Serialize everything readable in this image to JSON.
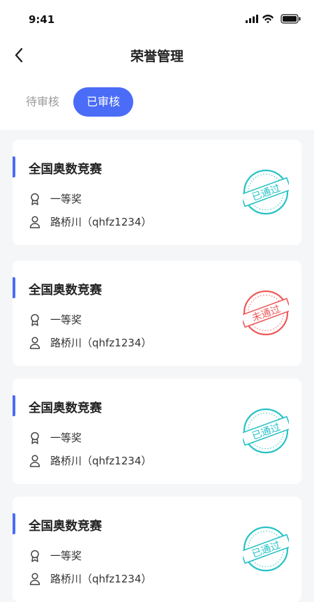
{
  "status_bar": {
    "time": "9:41"
  },
  "header": {
    "title": "荣誉管理"
  },
  "tabs": [
    {
      "label": "待审核",
      "active": false
    },
    {
      "label": "已审核",
      "active": true
    }
  ],
  "cards": [
    {
      "title": "全国奥数竞赛",
      "award": "一等奖",
      "person": "路桥川（qhfz1234）",
      "status": "已通过",
      "status_color": "#27c2c6"
    },
    {
      "title": "全国奥数竞赛",
      "award": "一等奖",
      "person": "路桥川（qhfz1234）",
      "status": "未通过",
      "status_color": "#ee5a5a"
    },
    {
      "title": "全国奥数竞赛",
      "award": "一等奖",
      "person": "路桥川（qhfz1234）",
      "status": "已通过",
      "status_color": "#27c2c6"
    },
    {
      "title": "全国奥数竞赛",
      "award": "一等奖",
      "person": "路桥川（qhfz1234）",
      "status": "已通过",
      "status_color": "#27c2c6"
    }
  ],
  "colors": {
    "accent": "#4a6cf7",
    "approved": "#27c2c6",
    "rejected": "#ee5a5a"
  },
  "icons": {
    "back": "chevron-left-icon",
    "award": "award-ribbon-icon",
    "user": "user-icon"
  }
}
